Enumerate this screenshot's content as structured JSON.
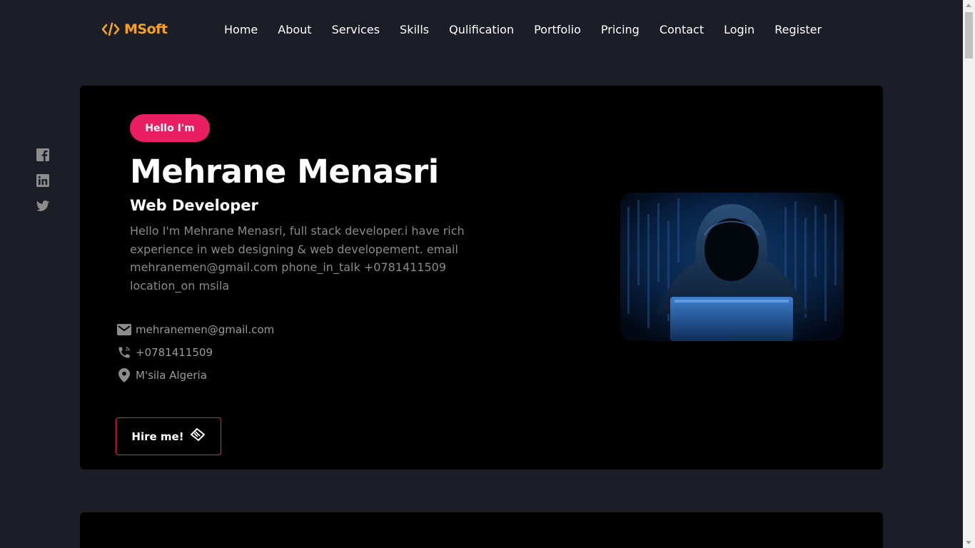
{
  "brand": {
    "name": "MSoft",
    "accent": "#f7a21b",
    "icon": "code-icon"
  },
  "nav": {
    "items": [
      {
        "label": "Home"
      },
      {
        "label": "About"
      },
      {
        "label": "Services"
      },
      {
        "label": "Skills"
      },
      {
        "label": "Qulification"
      },
      {
        "label": "Portfolio"
      },
      {
        "label": "Pricing"
      },
      {
        "label": "Contact"
      },
      {
        "label": "Login"
      },
      {
        "label": "Register"
      }
    ]
  },
  "social": {
    "icons": [
      "facebook-icon",
      "linkedin-icon",
      "twitter-icon"
    ],
    "color": "#8c8c8c"
  },
  "hero": {
    "badge": "Hello I'm",
    "badge_color": "#e91e63",
    "name": "Mehrane Menasri",
    "role": "Web Developer",
    "description": "Hello I'm Mehrane Menasri, full stack developer.i have rich experience in web designing & web developement. email mehranemen@gmail.com phone_in_talk +0781411509 location_on msila",
    "contacts": [
      {
        "icon": "email-icon",
        "text": "mehranemen@gmail.com"
      },
      {
        "icon": "phone-icon",
        "text": "+0781411509"
      },
      {
        "icon": "location-icon",
        "text": "M'sila Algeria"
      }
    ],
    "hire_label": "Hire me!",
    "hire_icon": "handshake-icon",
    "image": "hooded-hacker-laptop-image"
  },
  "colors": {
    "page_bg": "#1b1e27",
    "card_bg": "#000000",
    "muted_text": "#8a8a8a"
  }
}
